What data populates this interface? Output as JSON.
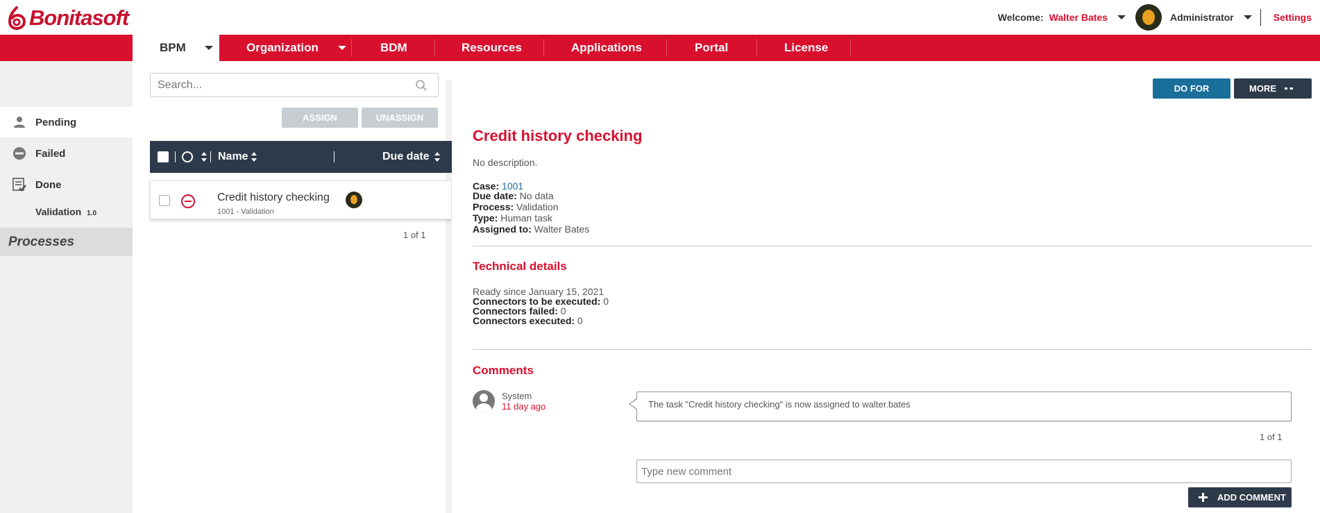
{
  "brand": {
    "name": "Bonitasoft",
    "color": "#d8102e"
  },
  "header": {
    "welcome_label": "Welcome:",
    "user_name": "Walter Bates",
    "role": "Administrator",
    "settings_label": "Settings"
  },
  "nav": {
    "items": [
      {
        "label": "BPM",
        "active": true,
        "has_menu": true
      },
      {
        "label": "Organization",
        "active": false,
        "has_menu": true
      },
      {
        "label": "BDM",
        "active": false,
        "has_menu": false
      },
      {
        "label": "Resources",
        "active": false,
        "has_menu": false
      },
      {
        "label": "Applications",
        "active": false,
        "has_menu": false
      },
      {
        "label": "Portal",
        "active": false,
        "has_menu": false
      },
      {
        "label": "License",
        "active": false,
        "has_menu": false
      }
    ]
  },
  "sidebar": {
    "filters": [
      {
        "label": "Pending",
        "icon": "user-icon",
        "active": true
      },
      {
        "label": "Failed",
        "icon": "failed-icon",
        "active": false
      },
      {
        "label": "Done",
        "icon": "done-icon",
        "active": false
      }
    ],
    "processes_title": "Processes",
    "processes": [
      {
        "name": "Validation",
        "version": "1.0"
      }
    ]
  },
  "list": {
    "search_placeholder": "Search...",
    "assign_label": "ASSIGN",
    "unassign_label": "UNASSIGN",
    "columns": {
      "name": "Name",
      "due_date": "Due date"
    },
    "rows": [
      {
        "name": "Credit history checking",
        "sub": "1001 - Validation",
        "state": "failed"
      }
    ],
    "pager": "1 of 1"
  },
  "details": {
    "do_for_label": "DO FOR",
    "more_label": "MORE",
    "title": "Credit history checking",
    "description": "No description.",
    "fields": {
      "case_label": "Case:",
      "case_value": "1001",
      "due_label": "Due date:",
      "due_value": "No data",
      "process_label": "Process:",
      "process_value": "Validation",
      "type_label": "Type:",
      "type_value": "Human task",
      "assigned_label": "Assigned to:",
      "assigned_value": "Walter Bates"
    },
    "technical_title": "Technical details",
    "technical": {
      "ready_since": "Ready since January 15, 2021",
      "to_execute_label": "Connectors to be executed:",
      "to_execute_value": "0",
      "failed_label": "Connectors failed:",
      "failed_value": "0",
      "executed_label": "Connectors executed:",
      "executed_value": "0"
    },
    "comments_title": "Comments",
    "comments": [
      {
        "author": "System",
        "time": "11 day ago",
        "text": "The task \"Credit history checking\" is now assigned to walter.bates"
      }
    ],
    "comments_pager": "1 of 1",
    "new_comment_placeholder": "Type new comment",
    "add_comment_label": "ADD COMMENT"
  }
}
